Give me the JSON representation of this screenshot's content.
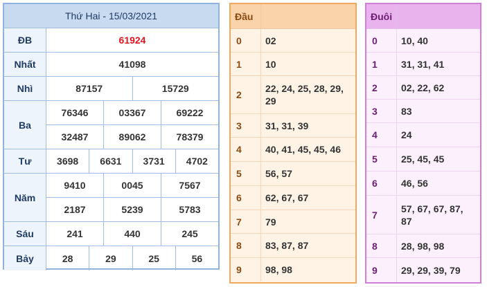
{
  "results": {
    "title": "Thứ Hai - 15/03/2021",
    "rows": [
      {
        "label": "ĐB",
        "lines": [
          [
            "61924"
          ]
        ],
        "special": true
      },
      {
        "label": "Nhất",
        "lines": [
          [
            "41098"
          ]
        ]
      },
      {
        "label": "Nhì",
        "lines": [
          [
            "87157",
            "15729"
          ]
        ]
      },
      {
        "label": "Ba",
        "lines": [
          [
            "76346",
            "03367",
            "69222"
          ],
          [
            "32487",
            "89062",
            "78379"
          ]
        ]
      },
      {
        "label": "Tư",
        "lines": [
          [
            "3698",
            "6631",
            "3731",
            "4702"
          ]
        ]
      },
      {
        "label": "Năm",
        "lines": [
          [
            "9410",
            "0045",
            "7567"
          ],
          [
            "2187",
            "5239",
            "5783"
          ]
        ]
      },
      {
        "label": "Sáu",
        "lines": [
          [
            "241",
            "440",
            "245"
          ]
        ]
      },
      {
        "label": "Bảy",
        "lines": [
          [
            "28",
            "29",
            "25",
            "56"
          ]
        ]
      }
    ]
  },
  "dau": {
    "header": "Đầu",
    "rows": [
      {
        "key": "0",
        "value": "02"
      },
      {
        "key": "1",
        "value": "10"
      },
      {
        "key": "2",
        "value": "22, 24, 25, 28, 29, 29"
      },
      {
        "key": "3",
        "value": "31, 31, 39"
      },
      {
        "key": "4",
        "value": "40, 41, 45, 45, 46"
      },
      {
        "key": "5",
        "value": "56, 57"
      },
      {
        "key": "6",
        "value": "62, 67, 67"
      },
      {
        "key": "7",
        "value": "79"
      },
      {
        "key": "8",
        "value": "83, 87, 87"
      },
      {
        "key": "9",
        "value": "98, 98"
      }
    ]
  },
  "duoi": {
    "header": "Đuôi",
    "rows": [
      {
        "key": "0",
        "value": "10, 40"
      },
      {
        "key": "1",
        "value": "31, 31, 41"
      },
      {
        "key": "2",
        "value": "02, 22, 62"
      },
      {
        "key": "3",
        "value": "83"
      },
      {
        "key": "4",
        "value": "24"
      },
      {
        "key": "5",
        "value": "25, 45, 45"
      },
      {
        "key": "6",
        "value": "46, 56"
      },
      {
        "key": "7",
        "value": "57, 67, 67, 87, 87"
      },
      {
        "key": "8",
        "value": "28, 98, 98"
      },
      {
        "key": "9",
        "value": "29, 29, 39, 79"
      }
    ]
  }
}
